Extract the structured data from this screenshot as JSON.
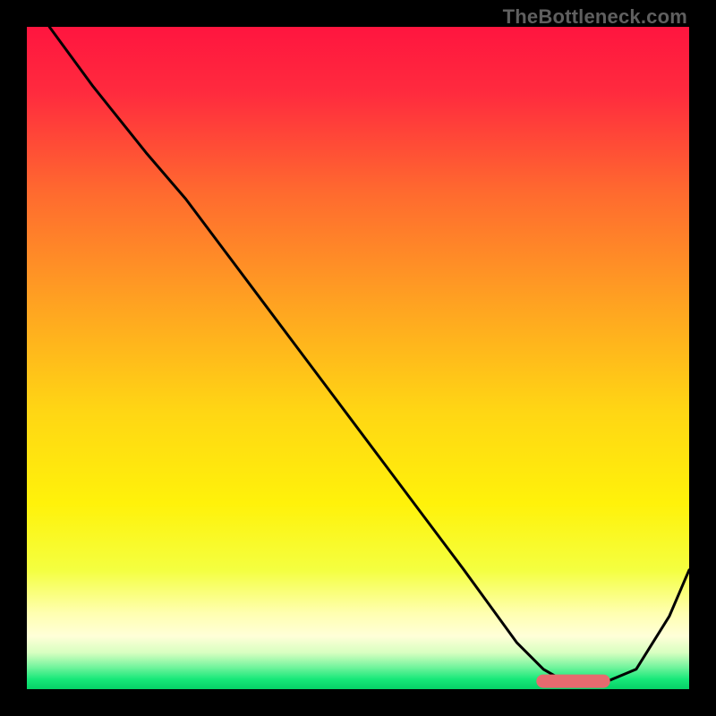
{
  "watermark": "TheBottleneck.com",
  "colors": {
    "gradient_stops": [
      {
        "offset": 0.0,
        "color": "#ff153f"
      },
      {
        "offset": 0.1,
        "color": "#ff2b3e"
      },
      {
        "offset": 0.25,
        "color": "#ff6a2f"
      },
      {
        "offset": 0.42,
        "color": "#ffa321"
      },
      {
        "offset": 0.58,
        "color": "#ffd614"
      },
      {
        "offset": 0.72,
        "color": "#fff20a"
      },
      {
        "offset": 0.82,
        "color": "#f4ff40"
      },
      {
        "offset": 0.885,
        "color": "#ffffb0"
      },
      {
        "offset": 0.92,
        "color": "#ffffd8"
      },
      {
        "offset": 0.945,
        "color": "#d8ffc0"
      },
      {
        "offset": 0.965,
        "color": "#7bf5a0"
      },
      {
        "offset": 0.985,
        "color": "#17e879"
      },
      {
        "offset": 1.0,
        "color": "#06d166"
      }
    ],
    "curve_stroke": "#000000",
    "marker_fill": "#e76a6f",
    "marker_stroke": "#e76a6f"
  },
  "chart_data": {
    "type": "line",
    "title": "",
    "xlabel": "",
    "ylabel": "",
    "xlim": [
      0,
      100
    ],
    "ylim": [
      0,
      100
    ],
    "note": "Values are relative percentages read from pixel positions; the chart has no numeric tick labels.",
    "series": [
      {
        "name": "bottleneck-curve",
        "x": [
          3.4,
          10,
          18,
          24,
          30,
          36,
          42,
          48,
          54,
          60,
          66,
          70,
          74,
          78,
          82,
          86,
          92,
          97,
          100
        ],
        "y": [
          100,
          91,
          81,
          74,
          66,
          58,
          50,
          42,
          34,
          26,
          18,
          12.5,
          7,
          3,
          0.7,
          0.5,
          3,
          11,
          18
        ]
      }
    ],
    "annotations": [
      {
        "name": "optimal-range-marker",
        "shape": "rounded-bar",
        "x_start": 77,
        "x_end": 88,
        "y": 1.2
      }
    ]
  }
}
